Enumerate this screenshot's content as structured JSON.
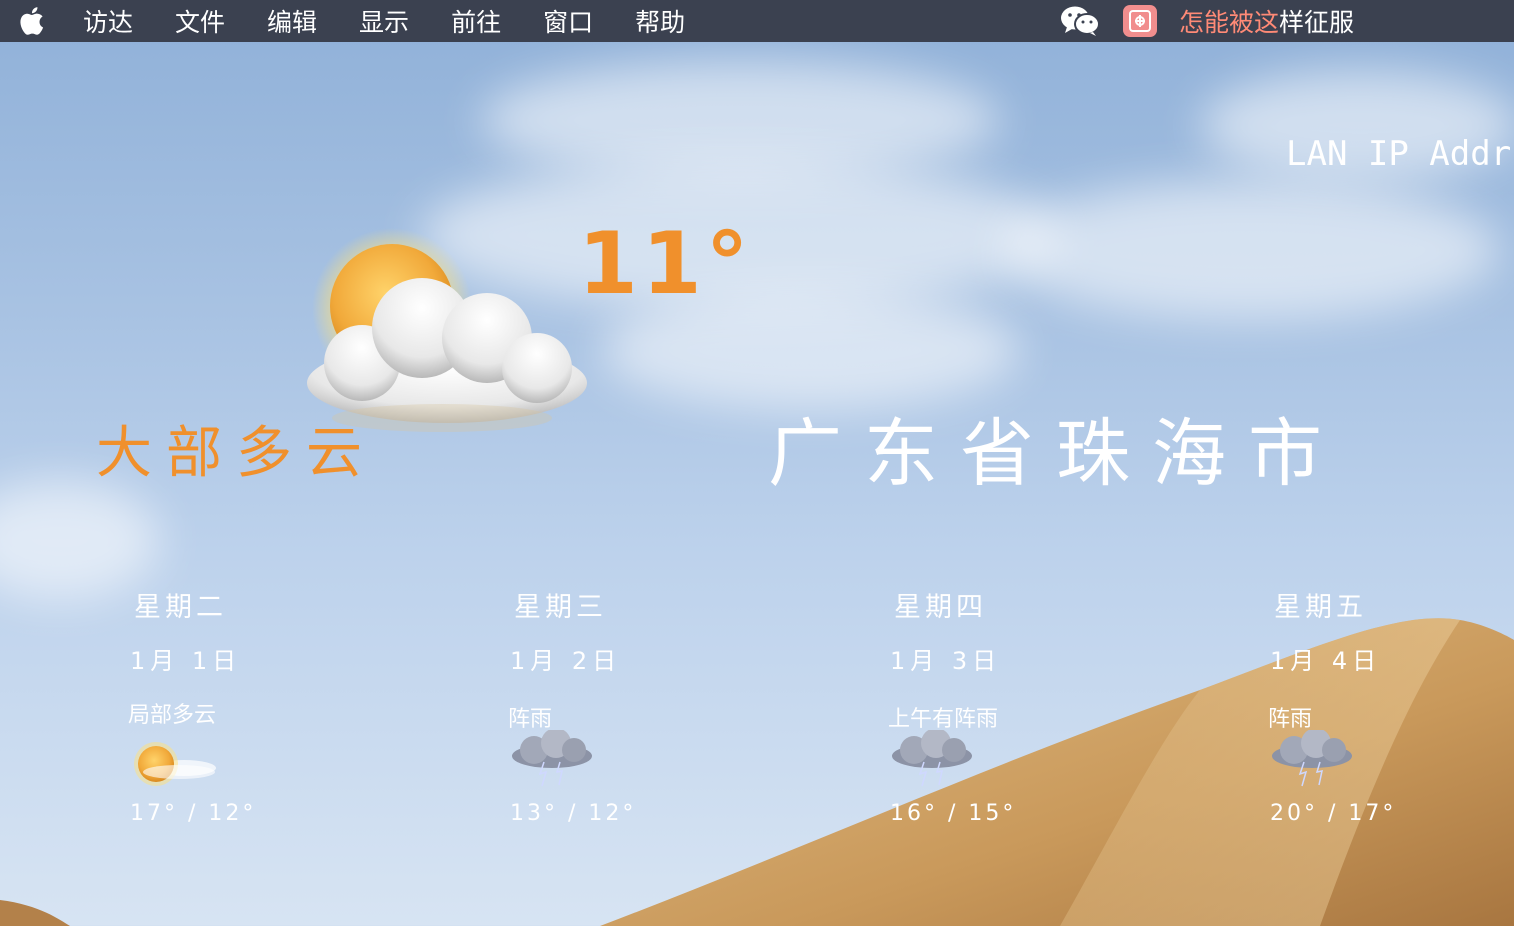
{
  "menubar": {
    "items": [
      "访达",
      "文件",
      "编辑",
      "显示",
      "前往",
      "窗口",
      "帮助"
    ],
    "song_highlight": "怎能被这",
    "song_rest": "样征服"
  },
  "network": {
    "label": "LAN IP Addr"
  },
  "weather": {
    "current_temp": "11°",
    "condition": "大部多云",
    "city": "广东省珠海市",
    "forecast": [
      {
        "day": "星期二",
        "date": "1月 1日",
        "desc": "局部多云",
        "temps": "17° / 12°",
        "icon": "sun-cloud-icon"
      },
      {
        "day": "星期三",
        "date": "1月 2日",
        "desc": "阵雨",
        "temps": "13° / 12°",
        "icon": "storm-cloud-icon"
      },
      {
        "day": "星期四",
        "date": "1月 3日",
        "desc": "上午有阵雨",
        "temps": "16° / 15°",
        "icon": "storm-cloud-icon"
      },
      {
        "day": "星期五",
        "date": "1月 4日",
        "desc": "阵雨",
        "temps": "20° / 17°",
        "icon": "storm-cloud-icon"
      }
    ]
  },
  "colors": {
    "accent": "#f0902c",
    "menubar": "#3b4150",
    "song": "#ff8a76"
  }
}
